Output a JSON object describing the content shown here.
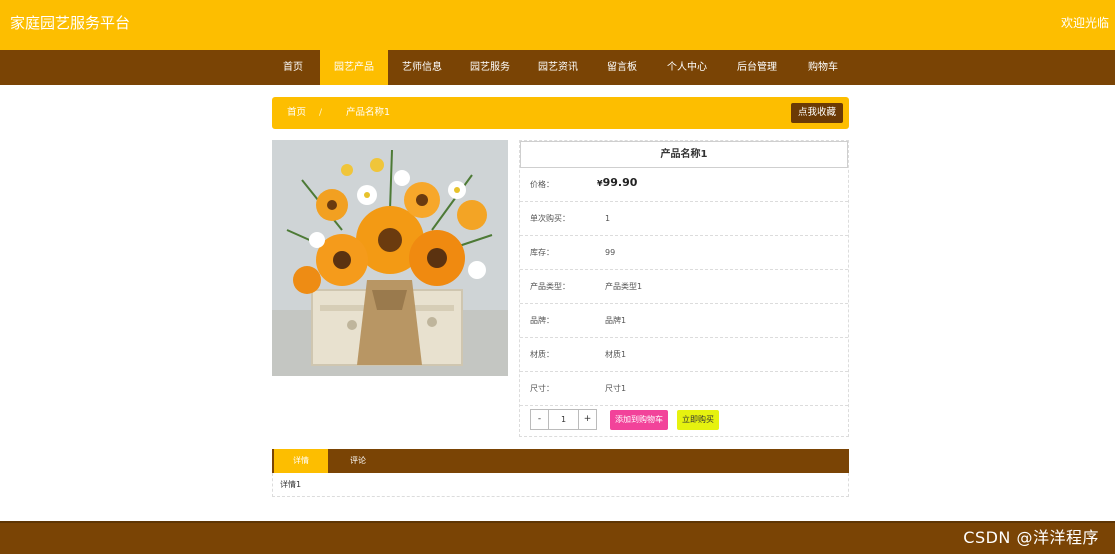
{
  "header": {
    "site_title": "家庭园艺服务平台",
    "welcome": "欢迎光临"
  },
  "nav": {
    "items": [
      {
        "label": "首页",
        "active": false
      },
      {
        "label": "园艺产品",
        "active": true
      },
      {
        "label": "艺师信息",
        "active": false
      },
      {
        "label": "园艺服务",
        "active": false
      },
      {
        "label": "园艺资讯",
        "active": false
      },
      {
        "label": "留言板",
        "active": false
      },
      {
        "label": "个人中心",
        "active": false
      },
      {
        "label": "后台管理",
        "active": false
      },
      {
        "label": "购物车",
        "active": false
      }
    ]
  },
  "breadcrumb": {
    "home": "首页",
    "separator": "/",
    "current": "产品名称1",
    "favorite_button": "点我收藏"
  },
  "product": {
    "image_description": "orange sunflower bouquet",
    "title": "产品名称1",
    "price_label": "价格：",
    "currency": "¥",
    "price": "99.90",
    "single_buy_label": "单次购买：",
    "single_buy": "1",
    "stock_label": "库存：",
    "stock": "99",
    "type_label": "产品类型：",
    "type": "产品类型1",
    "brand_label": "品牌：",
    "brand": "品牌1",
    "material_label": "材质：",
    "material": "材质1",
    "size_label": "尺寸：",
    "size": "尺寸1"
  },
  "purchase": {
    "minus": "-",
    "quantity": "1",
    "plus": "+",
    "add_to_cart": "添加到购物车",
    "buy_now": "立即购买"
  },
  "tabs": {
    "items": [
      {
        "label": "详情",
        "active": true
      },
      {
        "label": "评论",
        "active": false
      }
    ],
    "content": "详情1"
  },
  "footer": {
    "watermark": "CSDN @洋洋程序"
  },
  "colors": {
    "primary_yellow": "#FDBE00",
    "primary_brown": "#7A4405",
    "cart_pink": "#F2439A",
    "buy_yellow": "#E6F20F"
  }
}
